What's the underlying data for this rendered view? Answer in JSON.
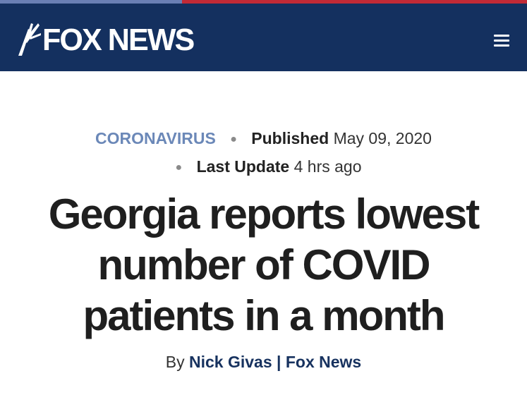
{
  "header": {
    "logo_text": "FOX NEWS",
    "menu_icon": "hamburger-menu-icon",
    "background_color": "#14305f"
  },
  "article": {
    "category": "CORONAVIRUS",
    "published_label": "Published",
    "published_date": "May 09, 2020",
    "updated_label": "Last Update",
    "updated_value": "4 hrs ago",
    "headline": "Georgia reports lowest number of COVID patients in a month",
    "byline_prefix": "By",
    "author": "Nick Givas",
    "separator": "|",
    "source": "Fox News"
  },
  "colors": {
    "category": "#6b88b8",
    "byline_link": "#17325f",
    "strip_blue": "#6a7fb4",
    "strip_red": "#c22a36"
  }
}
